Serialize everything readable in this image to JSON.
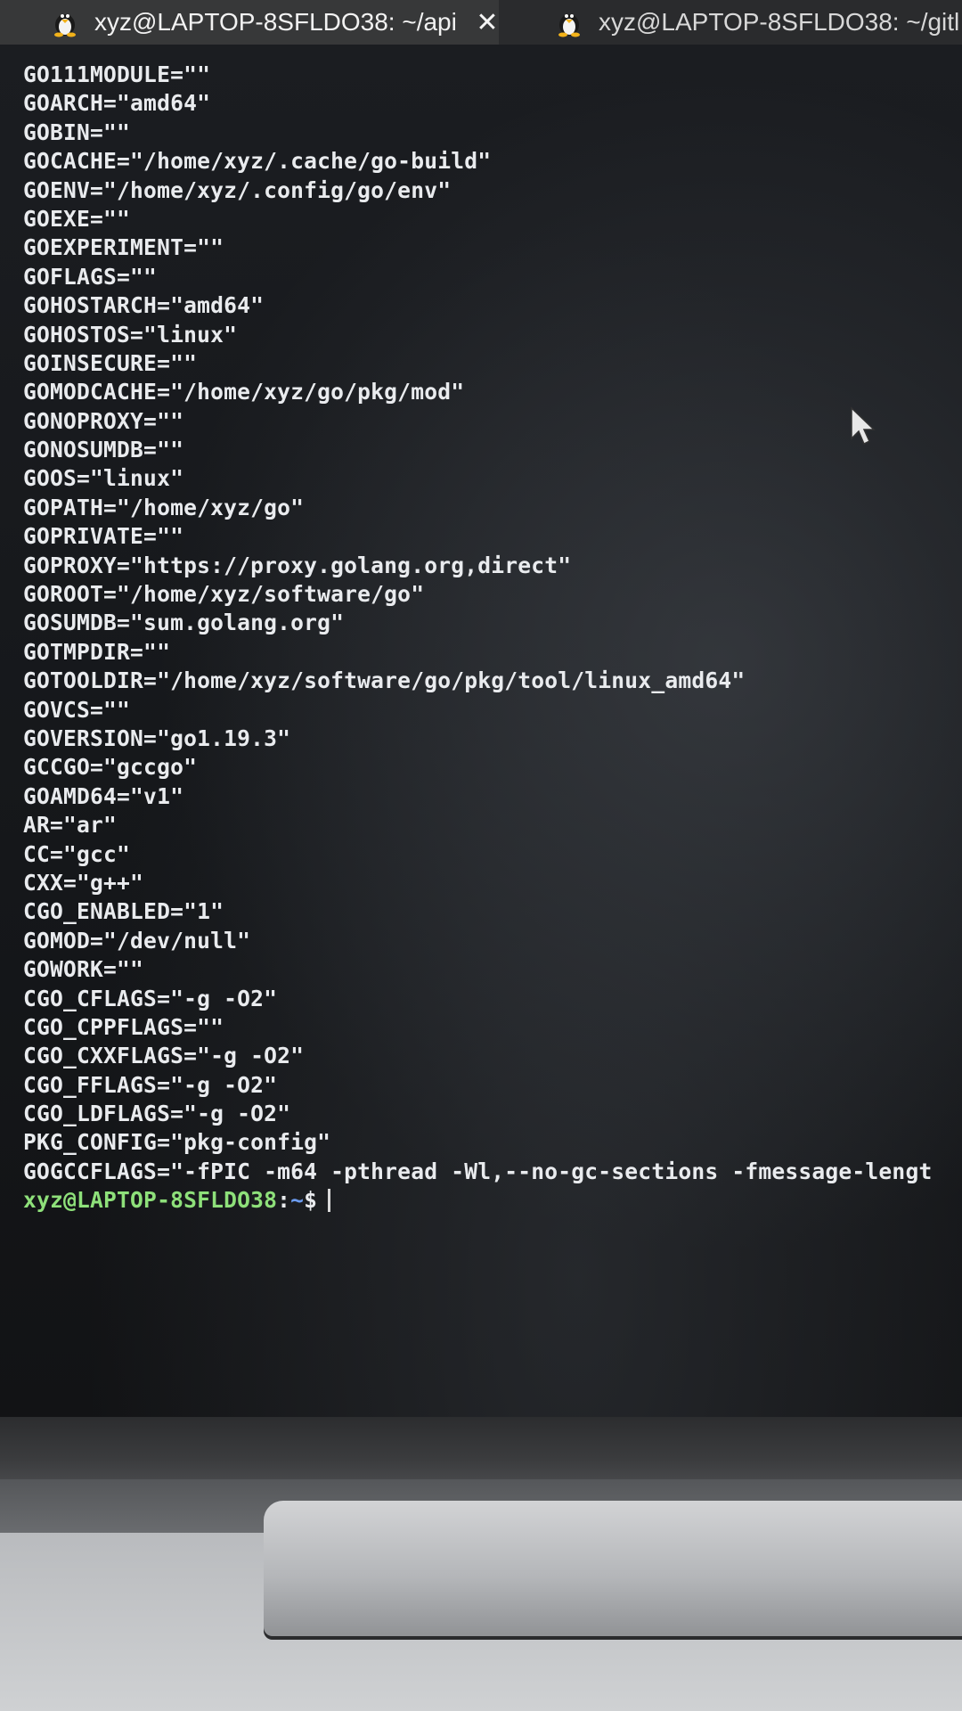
{
  "tabs": [
    {
      "label": "xyz@LAPTOP-8SFLDO38: ~/api",
      "active": true
    },
    {
      "label": "xyz@LAPTOP-8SFLDO38: ~/gitl",
      "active": false
    }
  ],
  "terminal": {
    "lines": [
      "GO111MODULE=\"\"",
      "GOARCH=\"amd64\"",
      "GOBIN=\"\"",
      "GOCACHE=\"/home/xyz/.cache/go-build\"",
      "GOENV=\"/home/xyz/.config/go/env\"",
      "GOEXE=\"\"",
      "GOEXPERIMENT=\"\"",
      "GOFLAGS=\"\"",
      "GOHOSTARCH=\"amd64\"",
      "GOHOSTOS=\"linux\"",
      "GOINSECURE=\"\"",
      "GOMODCACHE=\"/home/xyz/go/pkg/mod\"",
      "GONOPROXY=\"\"",
      "GONOSUMDB=\"\"",
      "GOOS=\"linux\"",
      "GOPATH=\"/home/xyz/go\"",
      "GOPRIVATE=\"\"",
      "GOPROXY=\"https://proxy.golang.org,direct\"",
      "GOROOT=\"/home/xyz/software/go\"",
      "GOSUMDB=\"sum.golang.org\"",
      "GOTMPDIR=\"\"",
      "GOTOOLDIR=\"/home/xyz/software/go/pkg/tool/linux_amd64\"",
      "GOVCS=\"\"",
      "GOVERSION=\"go1.19.3\"",
      "GCCGO=\"gccgo\"",
      "GOAMD64=\"v1\"",
      "AR=\"ar\"",
      "CC=\"gcc\"",
      "CXX=\"g++\"",
      "CGO_ENABLED=\"1\"",
      "GOMOD=\"/dev/null\"",
      "GOWORK=\"\"",
      "CGO_CFLAGS=\"-g -O2\"",
      "CGO_CPPFLAGS=\"\"",
      "CGO_CXXFLAGS=\"-g -O2\"",
      "CGO_FFLAGS=\"-g -O2\"",
      "CGO_LDFLAGS=\"-g -O2\"",
      "PKG_CONFIG=\"pkg-config\"",
      "GOGCCFLAGS=\"-fPIC -m64 -pthread -Wl,--no-gc-sections -fmessage-lengt"
    ],
    "prompt": {
      "user_host": "xyz@LAPTOP-8SFLDO38",
      "colon": ":",
      "path": "~",
      "dollar": "$"
    }
  },
  "icons": {
    "tab_icon": "tux-penguin-icon",
    "close": "close-icon",
    "pointer": "mouse-pointer-icon"
  },
  "colors": {
    "terminal_bg": "#15171a",
    "text": "#e9ebee",
    "prompt_user": "#8ee07a",
    "prompt_path": "#6c9cf0"
  }
}
